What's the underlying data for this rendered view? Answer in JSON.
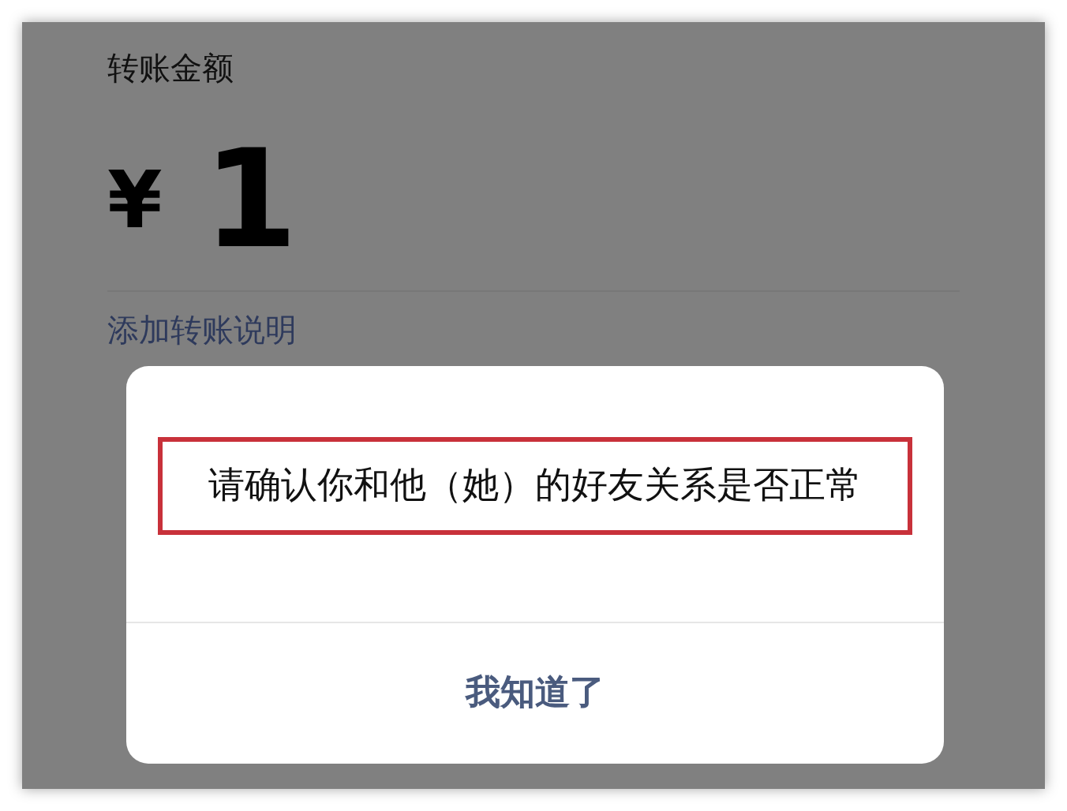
{
  "transfer": {
    "label": "转账金额",
    "currency": "¥",
    "amount": "1",
    "note_link": "添加转账说明"
  },
  "dialog": {
    "message": "请确认你和他（她）的好友关系是否正常",
    "highlighted": true,
    "buttons": [
      "我知道了"
    ]
  }
}
